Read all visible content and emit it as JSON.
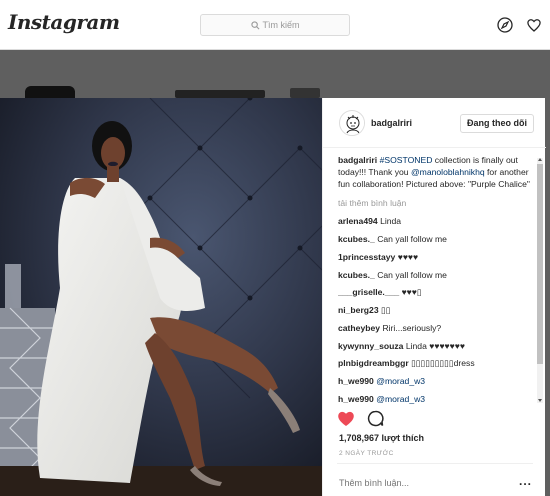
{
  "app": {
    "logo_text": "Instagram"
  },
  "search": {
    "placeholder": "Tìm kiếm"
  },
  "post": {
    "username": "badgalriri",
    "follow_label": "Đang theo dõi",
    "caption": {
      "user": "badgalriri",
      "hashtag": "#SOSTONED",
      "text_1": " collection is finally out today!!! Thank you ",
      "mention": "@manoloblahnikhq",
      "text_2": " for another fun collaboration! Pictured above: \"Purple Chalice\""
    },
    "load_more": "tải thêm bình luận",
    "comments": [
      {
        "user": "arlena494",
        "text": "Linda",
        "mention": ""
      },
      {
        "user": "kcubes._",
        "text": "Can yall follow me",
        "mention": ""
      },
      {
        "user": "1princesstayy",
        "text": "♥♥♥♥",
        "mention": ""
      },
      {
        "user": "kcubes._",
        "text": "Can yall follow me",
        "mention": ""
      },
      {
        "user": "___griselle.___",
        "text": "♥♥♥▯",
        "mention": ""
      },
      {
        "user": "ni_berg23",
        "text": "▯▯",
        "mention": ""
      },
      {
        "user": "catheybey",
        "text": "Riri...seriously?",
        "mention": ""
      },
      {
        "user": "kywynny_souza",
        "text": "Linda ♥♥♥♥♥♥♥",
        "mention": ""
      },
      {
        "user": "plnbigdreambggr",
        "text": "▯▯▯▯▯▯▯▯▯dress",
        "mention": ""
      },
      {
        "user": "h_we990",
        "text": "",
        "mention": "@morad_w3"
      },
      {
        "user": "h_we990",
        "text": "",
        "mention": "@morad_w3"
      }
    ],
    "likes": "1,708,967 lượt thích",
    "time": "2 NGÀY TRƯỚC",
    "comment_placeholder": "Thêm bình luận...",
    "more_options": "..."
  },
  "colors": {
    "like_red": "#ed4956",
    "link_blue": "#003569"
  }
}
